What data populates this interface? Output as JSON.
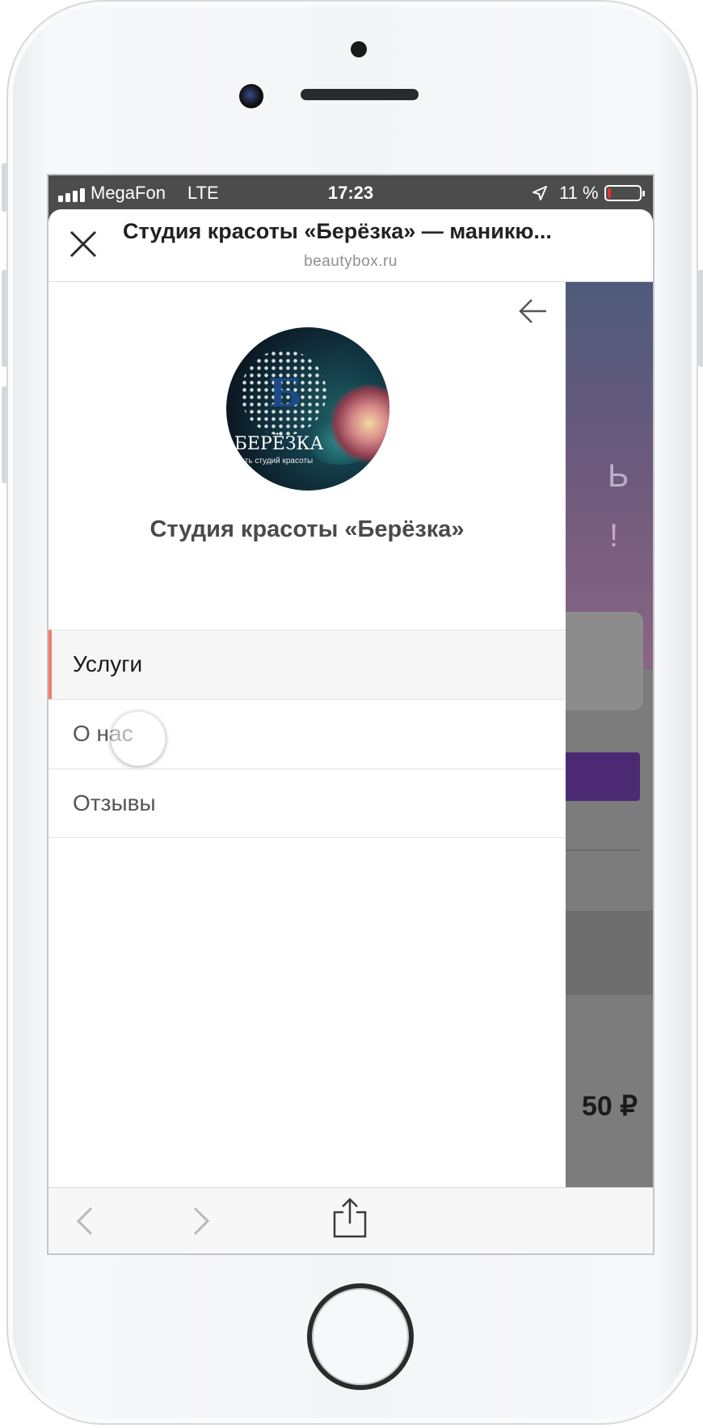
{
  "status_bar": {
    "carrier": "MegaFon",
    "network": "LTE",
    "time": "17:23",
    "battery": "11 %",
    "battery_level": 0.11,
    "battery_color": "#e8332a"
  },
  "browser": {
    "page_title": "Студия красоты «Берёзка» — маникю...",
    "domain": "beautybox.ru",
    "icons": [
      "close-icon",
      "back-icon",
      "forward-icon",
      "share-icon"
    ]
  },
  "drawer": {
    "logo": {
      "brand": "БЕРЁЗКА",
      "tagline": "ть студий красоты",
      "letter": "Б"
    },
    "salon_name": "Студия красоты «Берёзка»",
    "menu": [
      {
        "label": "Услуги",
        "active": true
      },
      {
        "label": "О нас",
        "active": false
      },
      {
        "label": "Отзывы",
        "active": false
      }
    ],
    "accent_color": "#ef7b6a"
  },
  "background_page": {
    "price_fragment": "50 ₽",
    "glyph_1": "Ь",
    "glyph_2": "!"
  }
}
